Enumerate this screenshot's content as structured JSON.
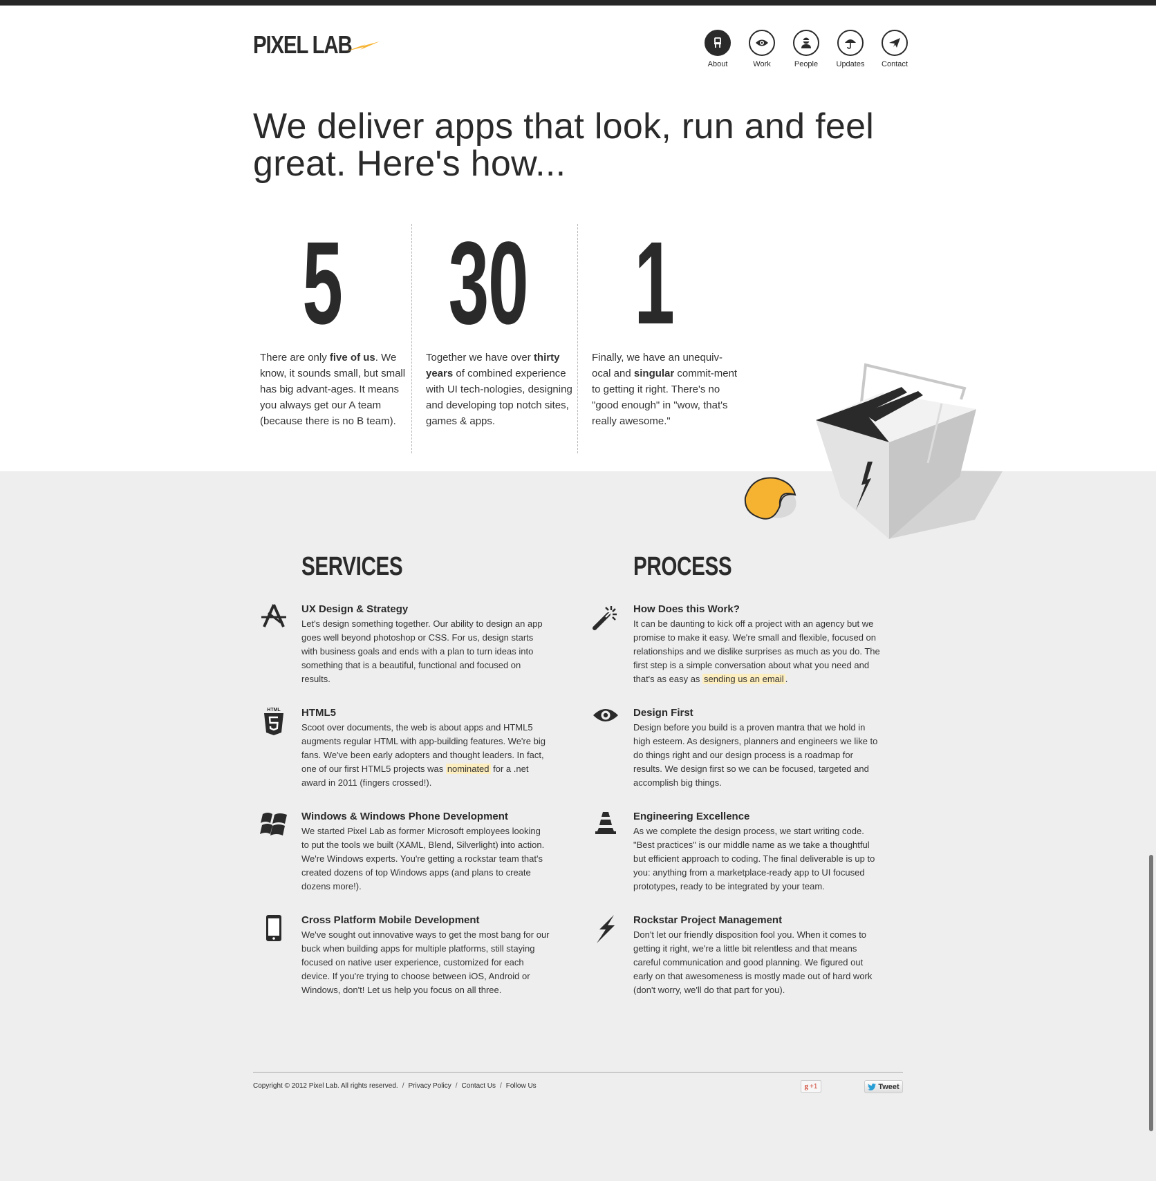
{
  "brand": {
    "logo_text": "PIXEL LAB",
    "accent_color": "#f6b331",
    "dark_color": "#2a2a2a"
  },
  "nav": {
    "items": [
      {
        "label": "About",
        "icon": "chair-icon",
        "active": true
      },
      {
        "label": "Work",
        "icon": "eye-icon",
        "active": false
      },
      {
        "label": "People",
        "icon": "person-icon",
        "active": false
      },
      {
        "label": "Updates",
        "icon": "umbrella-icon",
        "active": false
      },
      {
        "label": "Contact",
        "icon": "paper-plane-icon",
        "active": false
      }
    ]
  },
  "headline": "We deliver apps that look, run and feel great. Here's how...",
  "stats": [
    {
      "number": "5",
      "pre": "There are only ",
      "bold": "five of us",
      "post": ". We know, it sounds small, but small has big advant-ages. It means you always get our A team (because there is no B team)."
    },
    {
      "number": "30",
      "pre": "Together we have over ",
      "bold": "thirty years",
      "post": " of combined experience with UI tech-nologies, designing and developing top notch sites, games & apps."
    },
    {
      "number": "1",
      "pre": "Finally, we have an unequiv-ocal and ",
      "bold": "singular",
      "post": " commit-ment to getting it right. There's no \"good enough\" in \"wow, that's really awesome.\""
    }
  ],
  "services": {
    "title": "SERVICES",
    "items": [
      {
        "icon": "app-store-icon",
        "title": "UX Design & Strategy",
        "body": "Let's design something together. Our ability to design an app goes well beyond photoshop or CSS. For us, design starts with business goals and ends with a plan to turn ideas into something that is a beautiful, functional and focused on results."
      },
      {
        "icon": "html5-icon",
        "icon_label": "HTML",
        "title": "HTML5",
        "body_pre": "Scoot over documents, the web is about apps and HTML5 augments regular HTML with app-building features. We're big fans. We've been early adopters and thought leaders. In fact, one of our first HTML5 projects was ",
        "body_link": "nominated",
        "body_post": " for a .net award in 2011 (fingers crossed!)."
      },
      {
        "icon": "windows-icon",
        "title": "Windows & Windows Phone Development",
        "body": "We started Pixel Lab as former Microsoft employees looking to put the tools we built (XAML, Blend, Silverlight) into action. We're Windows experts. You're getting a rockstar team that's created dozens of top Windows apps (and plans to create dozens more!)."
      },
      {
        "icon": "mobile-phone-icon",
        "title": "Cross Platform Mobile Development",
        "body": "We've sought out innovative ways to get the most bang for our buck when building apps for multiple platforms, still staying focused on native user experience, customized for each device. If you're trying to choose between iOS, Android or Windows, don't! Let us help you focus on all three."
      }
    ]
  },
  "process": {
    "title": "PROCESS",
    "items": [
      {
        "icon": "magic-wand-icon",
        "title": "How Does this Work?",
        "body_pre": "It can be daunting to kick off a project with an agency but we promise to make it easy. We're small and flexible, focused on relationships and we dislike surprises as much as you do. The first step is a simple conversation about what you need and that's as easy as ",
        "body_link": "sending us an email",
        "body_post": "."
      },
      {
        "icon": "eye-icon",
        "title": "Design First",
        "body": "Design before you build is a proven mantra that we hold in high esteem. As designers, planners and engineers we like to do things right and our design process is a roadmap for results. We design first so we can be focused, targeted and accomplish big things."
      },
      {
        "icon": "traffic-cone-icon",
        "title": "Engineering Excellence",
        "body": "As we complete the design process, we start writing code. \"Best practices\" is our middle name as we take a thoughtful but efficient approach to coding. The final deliverable is up to you: anything from a marketplace-ready app to UI focused prototypes, ready to be integrated by your team."
      },
      {
        "icon": "lightning-bolt-icon",
        "title": "Rockstar Project Management",
        "body": "Don't let our friendly disposition fool you. When it comes to getting it right, we're a little bit relentless and that means careful communication and good planning. We figured out early on that awesomeness is mostly made out of hard work (don't worry, we'll do that part for you)."
      }
    ]
  },
  "footer": {
    "copyright": "Copyright © 2012 Pixel Lab. All rights reserved.",
    "sep": "/",
    "links": [
      "Privacy Policy",
      "Contact Us",
      "Follow Us"
    ],
    "gplus_label": "+1",
    "gplus_icon_text": "g",
    "tweet_label": "Tweet"
  }
}
